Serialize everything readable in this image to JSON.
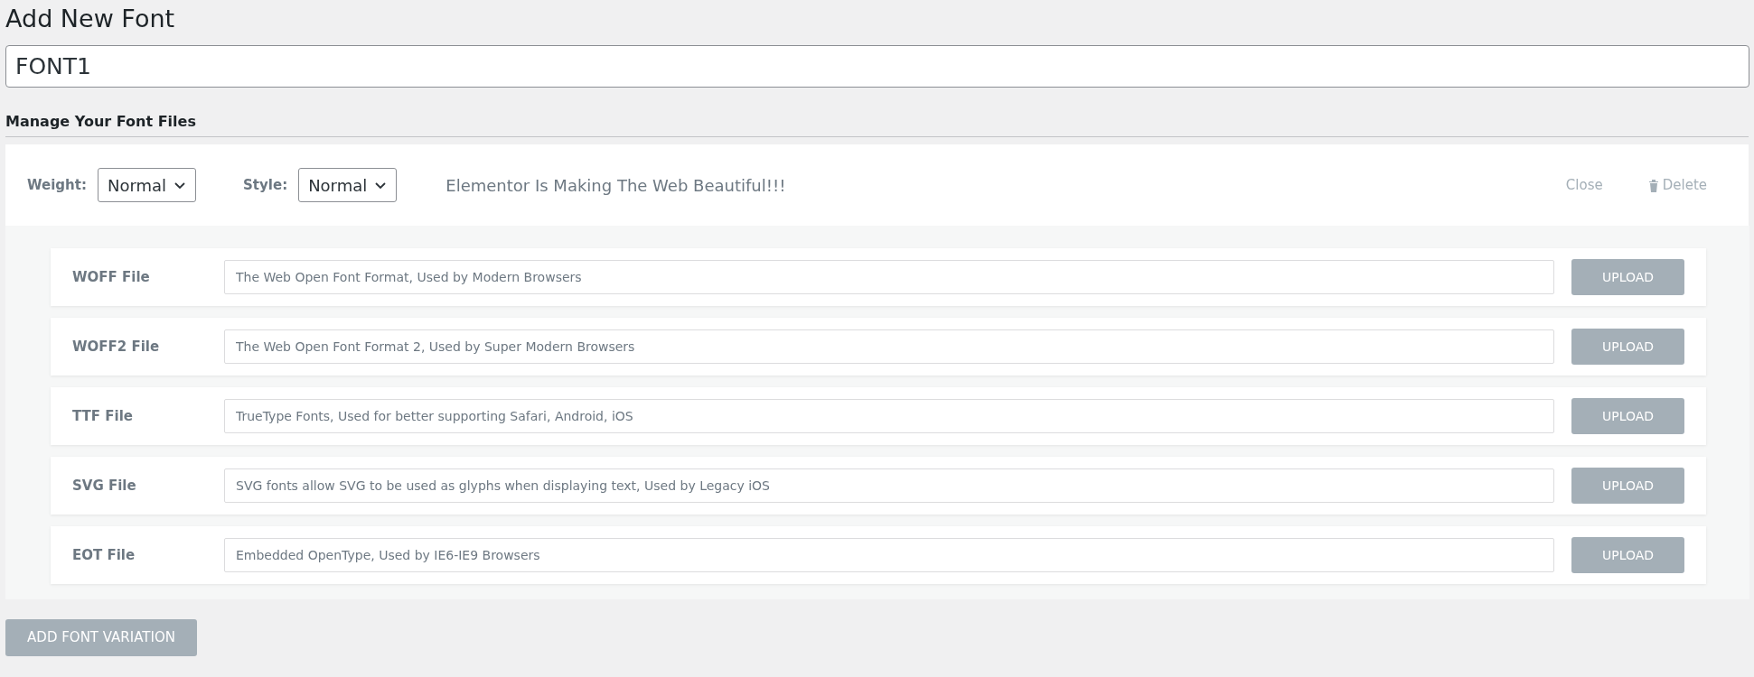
{
  "title": "Add New Font",
  "font_name": {
    "value": "FONT1"
  },
  "section_title": "Manage Your Font Files",
  "variation": {
    "weight": {
      "label": "Weight:",
      "value": "Normal"
    },
    "style": {
      "label": "Style:",
      "value": "Normal"
    },
    "preview": "Elementor Is Making The Web Beautiful!!!",
    "close": "Close",
    "delete": "Delete"
  },
  "files": [
    {
      "label": "WOFF File",
      "placeholder": "The Web Open Font Format, Used by Modern Browsers",
      "button": "UPLOAD"
    },
    {
      "label": "WOFF2 File",
      "placeholder": "The Web Open Font Format 2, Used by Super Modern Browsers",
      "button": "UPLOAD"
    },
    {
      "label": "TTF File",
      "placeholder": "TrueType Fonts, Used for better supporting Safari, Android, iOS",
      "button": "UPLOAD"
    },
    {
      "label": "SVG File",
      "placeholder": "SVG fonts allow SVG to be used as glyphs when displaying text, Used by Legacy iOS",
      "button": "UPLOAD"
    },
    {
      "label": "EOT File",
      "placeholder": "Embedded OpenType, Used by IE6-IE9 Browsers",
      "button": "UPLOAD"
    }
  ],
  "add_button": "ADD FONT VARIATION"
}
